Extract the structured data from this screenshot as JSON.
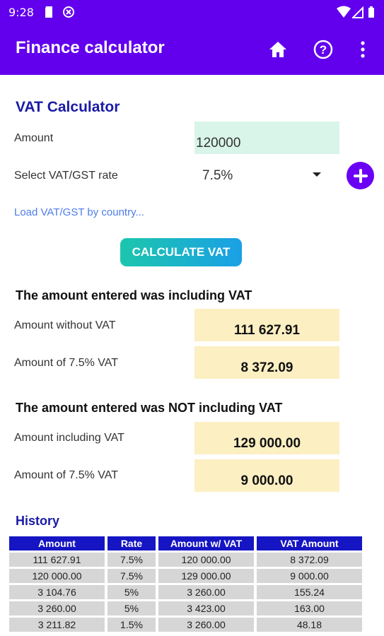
{
  "status_bar": {
    "time": "9:28",
    "icons": [
      "sd-card-icon",
      "sync-icon",
      "wifi-icon",
      "signal-icon",
      "battery-icon"
    ]
  },
  "app_bar": {
    "title": "Finance calculator",
    "actions": [
      "home-icon",
      "help-icon",
      "more-vert-icon"
    ],
    "color": "#6200ee"
  },
  "calculator": {
    "title": "VAT Calculator",
    "amount_label": "Amount",
    "amount_value": "120000",
    "rate_label": "Select VAT/GST rate",
    "rate_value": "7.5%",
    "load_link": "Load VAT/GST by country...",
    "calculate_button": "CALCULATE VAT"
  },
  "including": {
    "heading": "The amount entered was including VAT",
    "without_label": "Amount without VAT",
    "without_value": "111 627.91",
    "vat_label": "Amount of 7.5% VAT",
    "vat_value": "8 372.09"
  },
  "excluding": {
    "heading": "The amount entered was NOT including VAT",
    "including_label": "Amount including VAT",
    "including_value": "129 000.00",
    "vat_label": "Amount of 7.5% VAT",
    "vat_value": "9 000.00"
  },
  "history": {
    "title": "History",
    "columns": [
      "Amount",
      "Rate",
      "Amount w/ VAT",
      "VAT Amount"
    ],
    "rows": [
      [
        "111 627.91",
        "7.5%",
        "120 000.00",
        "8 372.09"
      ],
      [
        "120 000.00",
        "7.5%",
        "129 000.00",
        "9 000.00"
      ],
      [
        "3 104.76",
        "5%",
        "3 260.00",
        "155.24"
      ],
      [
        "3 260.00",
        "5%",
        "3 423.00",
        "163.00"
      ],
      [
        "3 211.82",
        "1.5%",
        "3 260.00",
        "48.18"
      ]
    ]
  }
}
